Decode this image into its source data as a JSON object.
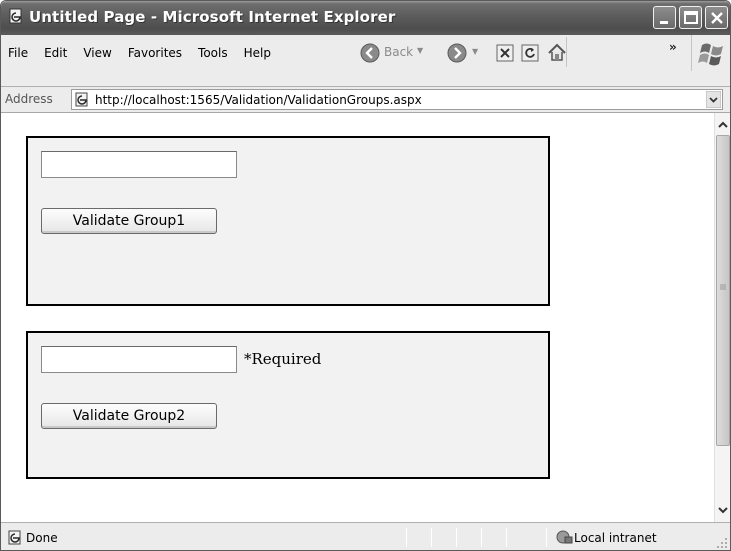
{
  "window": {
    "title": "Untitled Page - Microsoft Internet Explorer",
    "controls": [
      "minimize-icon",
      "maximize-icon",
      "close-icon"
    ]
  },
  "menu": {
    "items": [
      "File",
      "Edit",
      "View",
      "Favorites",
      "Tools",
      "Help"
    ]
  },
  "toolbar": {
    "back_label": "Back",
    "icons": [
      "back-icon",
      "forward-icon",
      "stop-icon",
      "refresh-icon",
      "home-icon",
      "windows-logo-icon"
    ]
  },
  "address": {
    "label": "Address",
    "url": "http://localhost:1565/Validation/ValidationGroups.aspx"
  },
  "page": {
    "group1": {
      "input_value": "",
      "button_label": "Validate Group1"
    },
    "group2": {
      "input_value": "",
      "required_text": "*Required",
      "button_label": "Validate Group2"
    }
  },
  "status": {
    "text": "Done",
    "zone": "Local intranet"
  }
}
